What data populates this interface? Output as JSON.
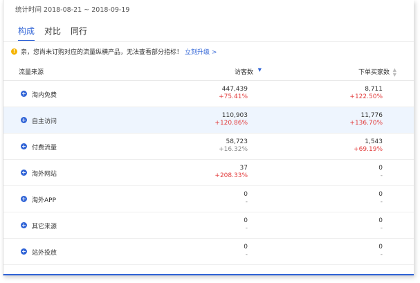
{
  "stats_period": "统计时间 2018-08-21 ~ 2018-09-19",
  "tabs": [
    {
      "label": "构成",
      "active": true
    },
    {
      "label": "对比",
      "active": false
    },
    {
      "label": "同行",
      "active": false
    }
  ],
  "notice": {
    "text": "亲，您尚未订购对应的流量纵横产品，无法查看部分指标！",
    "link": "立刻升级 >"
  },
  "table": {
    "columns": {
      "source": "流量来源",
      "visitors": "访客数",
      "buyers": "下单买家数"
    },
    "rows": [
      {
        "source": "淘内免费",
        "visitors": "447,439",
        "visitors_change": "+75.41%",
        "buyers": "8,711",
        "buyers_change": "+122.50%",
        "highlighted": false
      },
      {
        "source": "自主访问",
        "visitors": "110,903",
        "visitors_change": "+120.86%",
        "buyers": "11,776",
        "buyers_change": "+136.70%",
        "highlighted": true
      },
      {
        "source": "付费流量",
        "visitors": "58,723",
        "visitors_change": "+16.32%",
        "buyers": "1,543",
        "buyers_change": "+69.19%",
        "highlighted": false
      },
      {
        "source": "淘外网站",
        "visitors": "37",
        "visitors_change": "+208.33%",
        "buyers": "0",
        "buyers_change": "-",
        "highlighted": false
      },
      {
        "source": "淘外APP",
        "visitors": "0",
        "visitors_change": "-",
        "buyers": "0",
        "buyers_change": "-",
        "highlighted": false
      },
      {
        "source": "其它来源",
        "visitors": "0",
        "visitors_change": "-",
        "buyers": "0",
        "buyers_change": "-",
        "highlighted": false
      },
      {
        "source": "站外投放",
        "visitors": "0",
        "visitors_change": "-",
        "buyers": "0",
        "buyers_change": "-",
        "highlighted": false
      }
    ]
  },
  "icons": {
    "notice": "warning-icon",
    "expand": "plus-circle-icon",
    "sort_visitors": "sort-desc-icon",
    "sort_buyers": "sort-icon"
  },
  "colors": {
    "accent": "#2f63d6",
    "increase": "#e23b3b",
    "warning": "#f5b400",
    "row_highlight": "#eef5fe"
  }
}
